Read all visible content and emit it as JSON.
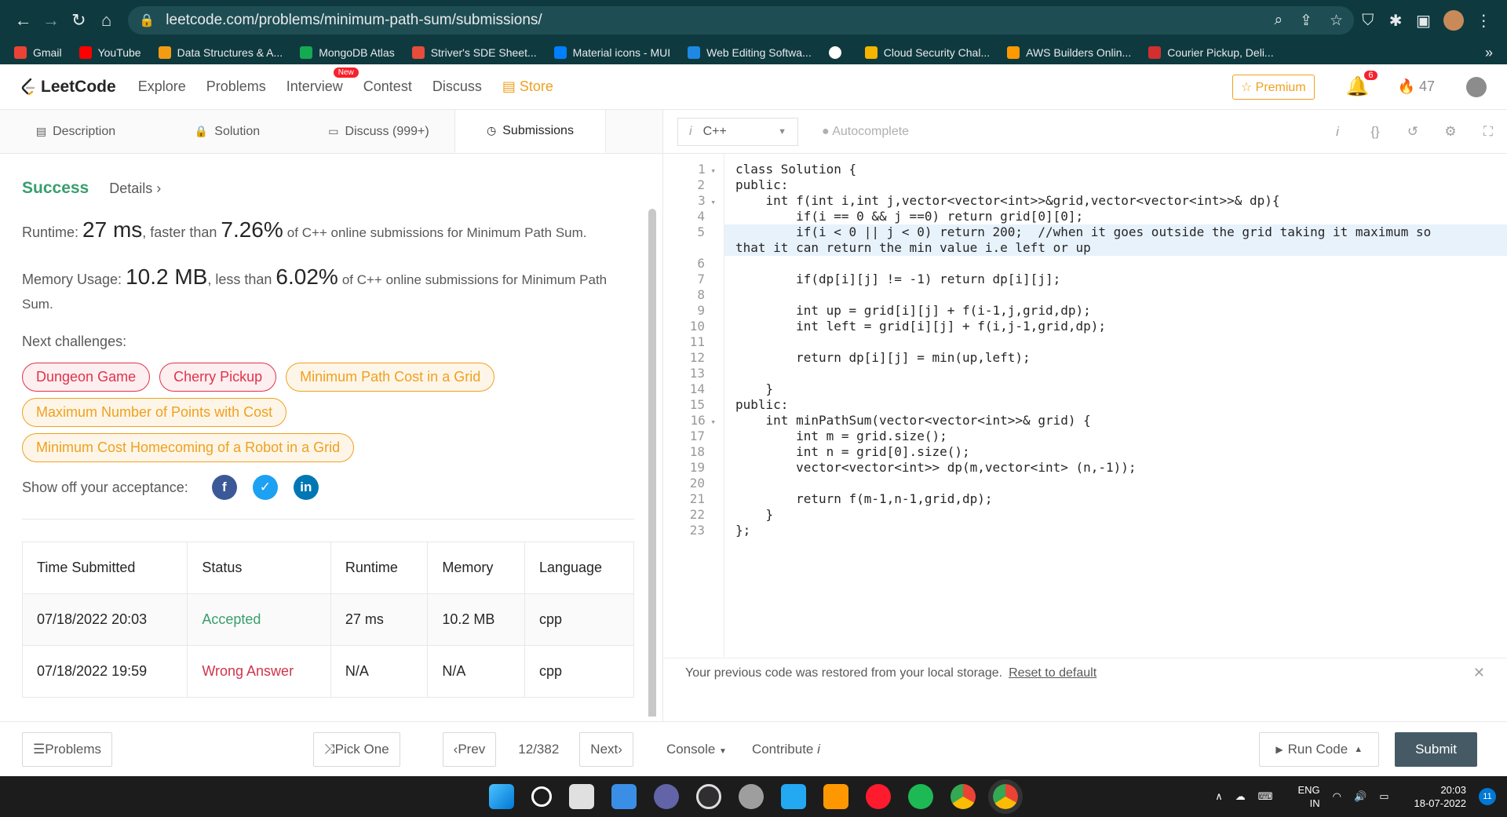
{
  "browser": {
    "url": "leetcode.com/problems/minimum-path-sum/submissions/",
    "bookmarks": [
      {
        "label": "Gmail",
        "color": "#ea4335"
      },
      {
        "label": "YouTube",
        "color": "#ff0000"
      },
      {
        "label": "Data Structures & A...",
        "color": "#f39c12"
      },
      {
        "label": "MongoDB Atlas",
        "color": "#13aa52"
      },
      {
        "label": "Striver's SDE Sheet...",
        "color": "#e74c3c"
      },
      {
        "label": "Material icons - MUI",
        "color": "#007fff"
      },
      {
        "label": "Web Editing Softwa...",
        "color": "#1e88e5"
      },
      {
        "label": "",
        "color": "#ffffff"
      },
      {
        "label": "Cloud Security Chal...",
        "color": "#f4b400"
      },
      {
        "label": "AWS Builders Onlin...",
        "color": "#ff9900"
      },
      {
        "label": "Courier Pickup, Deli...",
        "color": "#d32f2f"
      }
    ],
    "more": "»"
  },
  "nav": {
    "logo": "LeetCode",
    "links": [
      "Explore",
      "Problems",
      "Interview",
      "Contest",
      "Discuss",
      "Store"
    ],
    "new_badge": "New",
    "premium": "☆ Premium",
    "notifications": "6",
    "streak": "47"
  },
  "tabs": [
    {
      "label": "Description",
      "icon": "document-icon"
    },
    {
      "label": "Solution",
      "icon": "lock-icon"
    },
    {
      "label": "Discuss (999+)",
      "icon": "chat-icon"
    },
    {
      "label": "Submissions",
      "icon": "clock-icon"
    }
  ],
  "result": {
    "status": "Success",
    "details": "Details",
    "runtime_label": "Runtime:",
    "runtime_value": "27 ms",
    "runtime_mid": ", faster than",
    "runtime_pct": "7.26%",
    "runtime_tail": "of C++ online submissions for Minimum Path Sum.",
    "memory_label": "Memory Usage:",
    "memory_value": "10.2 MB",
    "memory_mid": ", less than",
    "memory_pct": "6.02%",
    "memory_tail": "of C++ online submissions for Minimum Path Sum.",
    "next_label": "Next challenges:",
    "challenges": [
      {
        "label": "Dungeon Game",
        "level": "hard"
      },
      {
        "label": "Cherry Pickup",
        "level": "hard"
      },
      {
        "label": "Minimum Path Cost in a Grid",
        "level": "med"
      },
      {
        "label": "Maximum Number of Points with Cost",
        "level": "med"
      },
      {
        "label": "Minimum Cost Homecoming of a Robot in a Grid",
        "level": "med"
      }
    ],
    "share_label": "Show off your acceptance:"
  },
  "table": {
    "headers": [
      "Time Submitted",
      "Status",
      "Runtime",
      "Memory",
      "Language"
    ],
    "rows": [
      [
        "07/18/2022 20:03",
        "Accepted",
        "27 ms",
        "10.2 MB",
        "cpp"
      ],
      [
        "07/18/2022 19:59",
        "Wrong Answer",
        "N/A",
        "N/A",
        "cpp"
      ]
    ]
  },
  "editor": {
    "language": "C++",
    "autocomplete": "Autocomplete",
    "code": [
      "class Solution {",
      "public:",
      "    int f(int i,int j,vector<vector<int>>&grid,vector<vector<int>>& dp){",
      "        if(i == 0 && j ==0) return grid[0][0];",
      "        if(i < 0 || j < 0) return 200;  //when it goes outside the grid taking it maximum so",
      "that it can return the min value i.e left or up",
      "",
      "        if(dp[i][j] != -1) return dp[i][j];",
      "",
      "        int up = grid[i][j] + f(i-1,j,grid,dp);",
      "        int left = grid[i][j] + f(i,j-1,grid,dp);",
      "",
      "        return dp[i][j] = min(up,left);",
      "",
      "    }",
      "public:",
      "    int minPathSum(vector<vector<int>>& grid) {",
      "        int m = grid.size();",
      "        int n = grid[0].size();",
      "        vector<vector<int>> dp(m,vector<int> (n,-1));",
      "",
      "        return f(m-1,n-1,grid,dp);",
      "    }",
      "};"
    ],
    "line_numbers": [
      "1",
      "2",
      "3",
      "4",
      "5",
      "",
      "6",
      "7",
      "8",
      "9",
      "10",
      "11",
      "12",
      "13",
      "14",
      "15",
      "16",
      "17",
      "18",
      "19",
      "20",
      "21",
      "22",
      "23"
    ],
    "notice": "Your previous code was restored from your local storage.",
    "reset": "Reset to default"
  },
  "bottom": {
    "problems": "Problems",
    "pick_one": "Pick One",
    "prev": "Prev",
    "page": "12/382",
    "next": "Next",
    "console": "Console",
    "contribute": "Contribute",
    "run_code": "Run Code",
    "submit": "Submit"
  },
  "taskbar": {
    "lang1": "ENG",
    "lang2": "IN",
    "time": "20:03",
    "date": "18-07-2022",
    "notifications": "11"
  }
}
